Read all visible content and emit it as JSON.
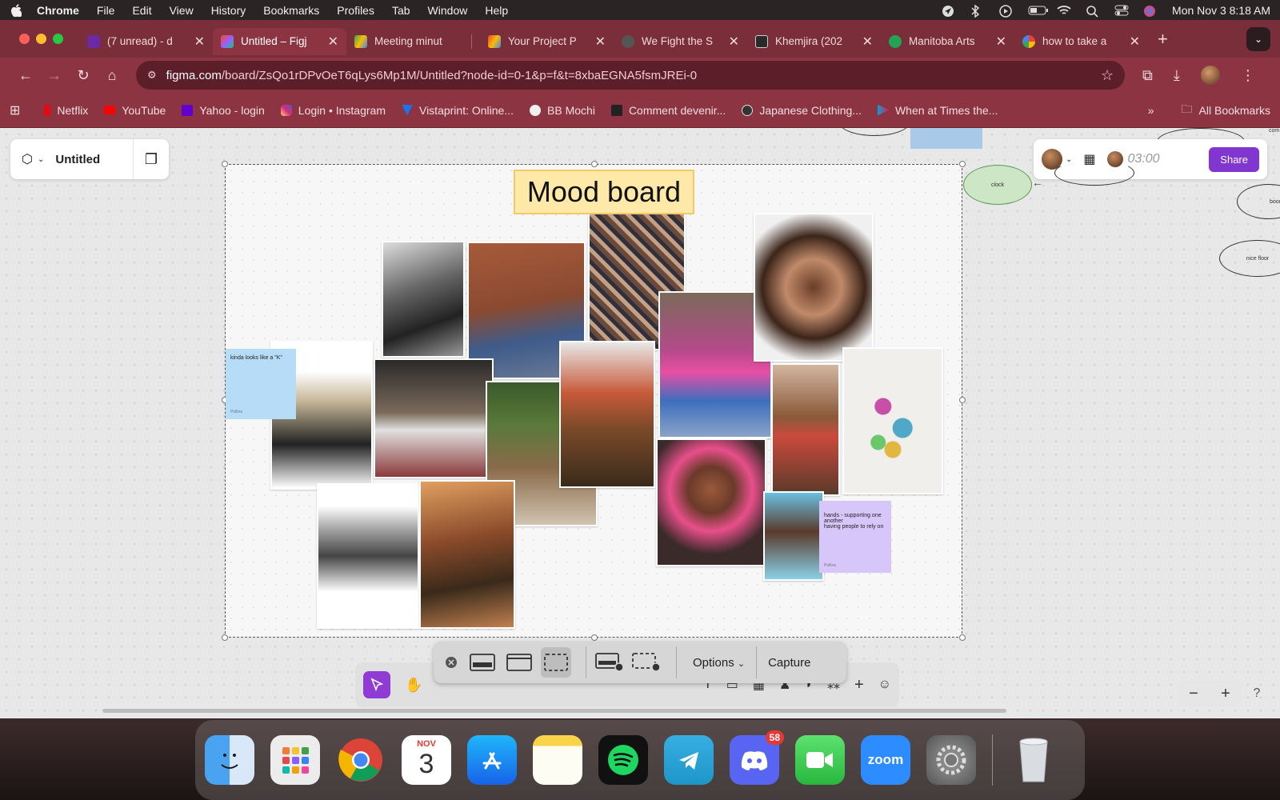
{
  "menubar": {
    "app": "Chrome",
    "items": [
      "File",
      "Edit",
      "View",
      "History",
      "Bookmarks",
      "Profiles",
      "Tab",
      "Window",
      "Help"
    ],
    "datetime": "Mon Nov 3  8:18 AM"
  },
  "tabs": [
    {
      "title": "(7 unread) - d",
      "color": "#6b2aa3"
    },
    {
      "title": "Untitled – Figj",
      "color": "#f24e1e",
      "active": true
    },
    {
      "title": "Meeting minut",
      "color": "#34a853"
    },
    {
      "title": "Your Project P",
      "color": "#ea4335"
    },
    {
      "title": "We Fight the S",
      "color": "#555555"
    },
    {
      "title": "Khemjira (202",
      "color": "#2a2a2a"
    },
    {
      "title": "Manitoba Arts",
      "color": "#23a455"
    },
    {
      "title": "how to take a",
      "color": "#4285f4"
    }
  ],
  "omnibox": {
    "host": "figma.com",
    "path": "/board/ZsQo1rDPvOeT6qLys6Mp1M/Untitled?node-id=0-1&p=f&t=8xbaEGNA5fsmJREi-0"
  },
  "bookmarks": [
    {
      "label": "Netflix",
      "color": "#e50914"
    },
    {
      "label": "YouTube",
      "color": "#ff0000"
    },
    {
      "label": "Yahoo - login",
      "color": "#6001d2"
    },
    {
      "label": "Login • Instagram",
      "color": "#d6249f"
    },
    {
      "label": "Vistaprint: Online...",
      "color": "#1a73e8"
    },
    {
      "label": "BB Mochi",
      "color": "#f0f0f0"
    },
    {
      "label": "Comment devenir...",
      "color": "#222222"
    },
    {
      "label": "Japanese Clothing...",
      "color": "#333333"
    },
    {
      "label": "When at Times the...",
      "color": "#00a0e0"
    }
  ],
  "bookmarks_all": "All Bookmarks",
  "figma": {
    "file_title": "Untitled",
    "timer": "03:00",
    "share_label": "Share"
  },
  "board": {
    "title": "Mood board",
    "sticky_blue": {
      "text": "kinda looks like a \"K\"",
      "author": "Pollina"
    },
    "sticky_purple": {
      "text": "hands - supporting one another\nhaving people to rely on",
      "author": "Pollina"
    }
  },
  "ellipses": [
    "clock",
    "boom bo",
    "nice floor",
    "com"
  ],
  "capture_bar": {
    "options_label": "Options",
    "capture_label": "Capture"
  },
  "dock": {
    "calendar_month": "NOV",
    "calendar_day": "3",
    "discord_badge": "58",
    "zoom_label": "zoom"
  }
}
